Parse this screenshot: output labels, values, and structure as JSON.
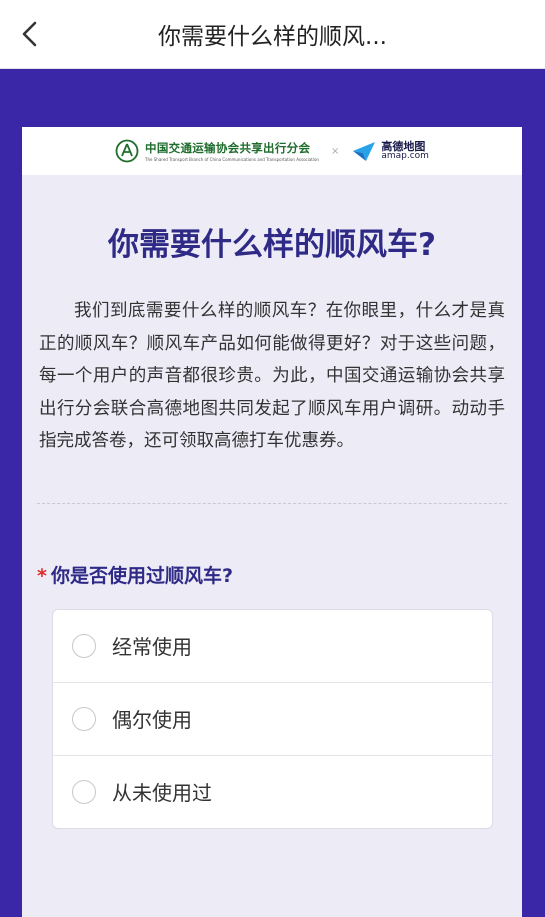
{
  "header": {
    "title": "你需要什么样的顺风...",
    "back_icon": "chevron-left-icon"
  },
  "logos": {
    "org_name": "中国交通运输协会共享出行分会",
    "org_sub": "The Shared Transport Branch of China Communications and Transportation Association",
    "separator": "×",
    "amap_cn": "高德地图",
    "amap_en": "amap.com"
  },
  "survey": {
    "title": "你需要什么样的顺风车?",
    "intro": "我们到底需要什么样的顺风车？在你眼里，什么才是真正的顺风车？顺风车产品如何能做得更好？对于这些问题，每一个用户的声音都很珍贵。为此，中国交通运输协会共享出行分会联合高德地图共同发起了顺风车用户调研。动动手指完成答卷，还可领取高德打车优惠券。"
  },
  "question1": {
    "required_mark": "*",
    "text": "你是否使用过顺风车?",
    "options": [
      {
        "label": "经常使用"
      },
      {
        "label": "偶尔使用"
      },
      {
        "label": "从未使用过"
      }
    ]
  },
  "colors": {
    "background": "#3a27a8",
    "card": "#ecebf6",
    "title": "#2e2a86",
    "required": "#e02a2a"
  }
}
